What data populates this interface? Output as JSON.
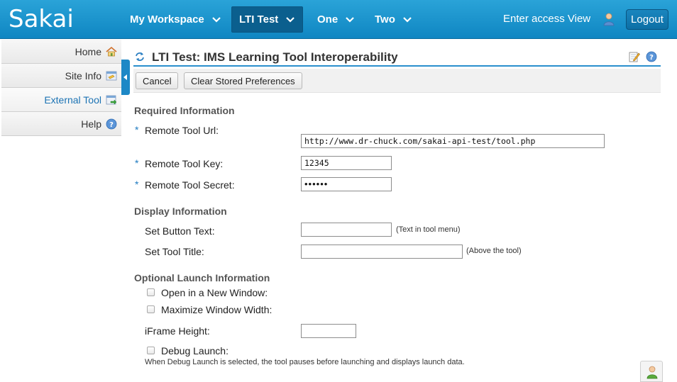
{
  "header": {
    "logo": "Sakai",
    "nav": [
      {
        "label": "My Workspace",
        "active": false
      },
      {
        "label": "LTI Test",
        "active": true
      },
      {
        "label": "One",
        "active": false
      },
      {
        "label": "Two",
        "active": false
      }
    ],
    "access_link": "Enter access View",
    "logout": "Logout"
  },
  "sidebar": {
    "items": [
      {
        "label": "Home",
        "icon": "home-icon"
      },
      {
        "label": "Site Info",
        "icon": "site-info-icon"
      },
      {
        "label": "External Tool",
        "icon": "external-tool-icon",
        "active": true
      },
      {
        "label": "Help",
        "icon": "help-icon"
      }
    ]
  },
  "page": {
    "title": "LTI Test: IMS Learning Tool Interoperability"
  },
  "buttons": {
    "cancel": "Cancel",
    "clear_prefs": "Clear Stored Preferences"
  },
  "required": {
    "heading": "Required Information",
    "marker": "*",
    "url_label": "Remote Tool Url:",
    "url_value": "http://www.dr-chuck.com/sakai-api-test/tool.php",
    "key_label": "Remote Tool Key:",
    "key_value": "12345",
    "secret_label": "Remote Tool Secret:",
    "secret_value": "••••••"
  },
  "display": {
    "heading": "Display Information",
    "button_text_label": "Set Button Text:",
    "button_text_value": "",
    "button_text_hint": "(Text in tool menu)",
    "tool_title_label": "Set Tool Title:",
    "tool_title_value": "",
    "tool_title_hint": "(Above the tool)"
  },
  "launch": {
    "heading": "Optional Launch Information",
    "new_window": "Open in a New Window:",
    "maximize_width": "Maximize Window Width:",
    "iframe_label": "iFrame Height:",
    "iframe_value": "",
    "debug": "Debug Launch:",
    "debug_note": "When Debug Launch is selected, the tool pauses before launching and displays launch data."
  },
  "colors": {
    "header_blue": "#1a95cf",
    "accent_blue": "#1f7bc0"
  }
}
